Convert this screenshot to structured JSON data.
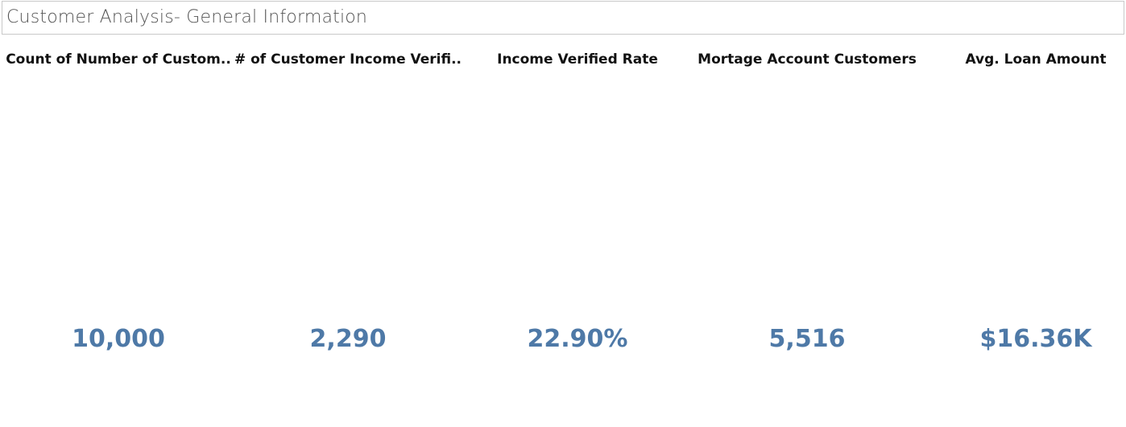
{
  "dashboard": {
    "title": "Customer Analysis- General Information"
  },
  "kpis": [
    {
      "header": "Count of Number of Custom..",
      "value": "10,000"
    },
    {
      "header": "# of Customer Income Verifi..",
      "value": "2,290"
    },
    {
      "header": "Income Verified Rate",
      "value": "22.90%"
    },
    {
      "header": "Mortage Account Customers",
      "value": "5,516"
    },
    {
      "header": "Avg. Loan Amount",
      "value": "$16.36K"
    }
  ],
  "colors": {
    "value_color": "#4e79a7",
    "header_color": "#111111",
    "title_color": "#555555"
  }
}
